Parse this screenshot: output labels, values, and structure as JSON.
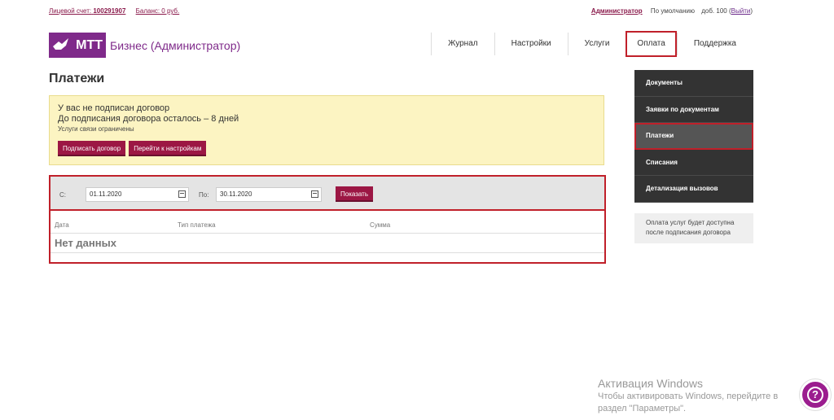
{
  "topbar": {
    "account_label": "Лицевой счет:",
    "account_number": "100291907",
    "balance": "Баланс: 0 руб.",
    "user": "Администратор",
    "default": "По умолчанию",
    "ext": "доб. 100",
    "exit_open": "(",
    "exit": "Выйти",
    "exit_close": ")"
  },
  "logo": {
    "brand": "МТТ",
    "name": "Бизнес (Администратор)"
  },
  "nav": {
    "items": [
      "Журнал",
      "Настройки",
      "Услуги",
      "Оплата",
      "Поддержка"
    ],
    "active": "Оплата"
  },
  "page_title": "Платежи",
  "notice": {
    "line1": "У вас не подписан договор",
    "line2": "До подписания договора осталось – 8 дней",
    "line3": "Услуги связи ограничены",
    "sign_button": "Подписать договор",
    "settings_button": "Перейти к настройкам"
  },
  "filter": {
    "from_label": "С:",
    "from_value": "01.11.2020",
    "to_label": "По:",
    "to_value": "30.11.2020",
    "show_button": "Показать"
  },
  "table": {
    "columns": [
      "Дата",
      "Тип платежа",
      "Сумма"
    ],
    "empty": "Нет данных"
  },
  "sidebar": {
    "items": [
      "Документы",
      "Заявки по документам",
      "Платежи",
      "Списания",
      "Детализация вызовов"
    ],
    "active": "Платежи",
    "note": "Оплата услуг будет доступна после подписания договора"
  },
  "watermark": {
    "title": "Активация Windows",
    "line1": "Чтобы активировать Windows, перейдите в",
    "line2": "раздел \"Параметры\"."
  },
  "colors": {
    "brand": "#7f2a8a",
    "accent": "#9c1744",
    "highlight": "#c0202a",
    "notice_bg": "#fcf4c2",
    "sidebar_bg": "#333333"
  }
}
